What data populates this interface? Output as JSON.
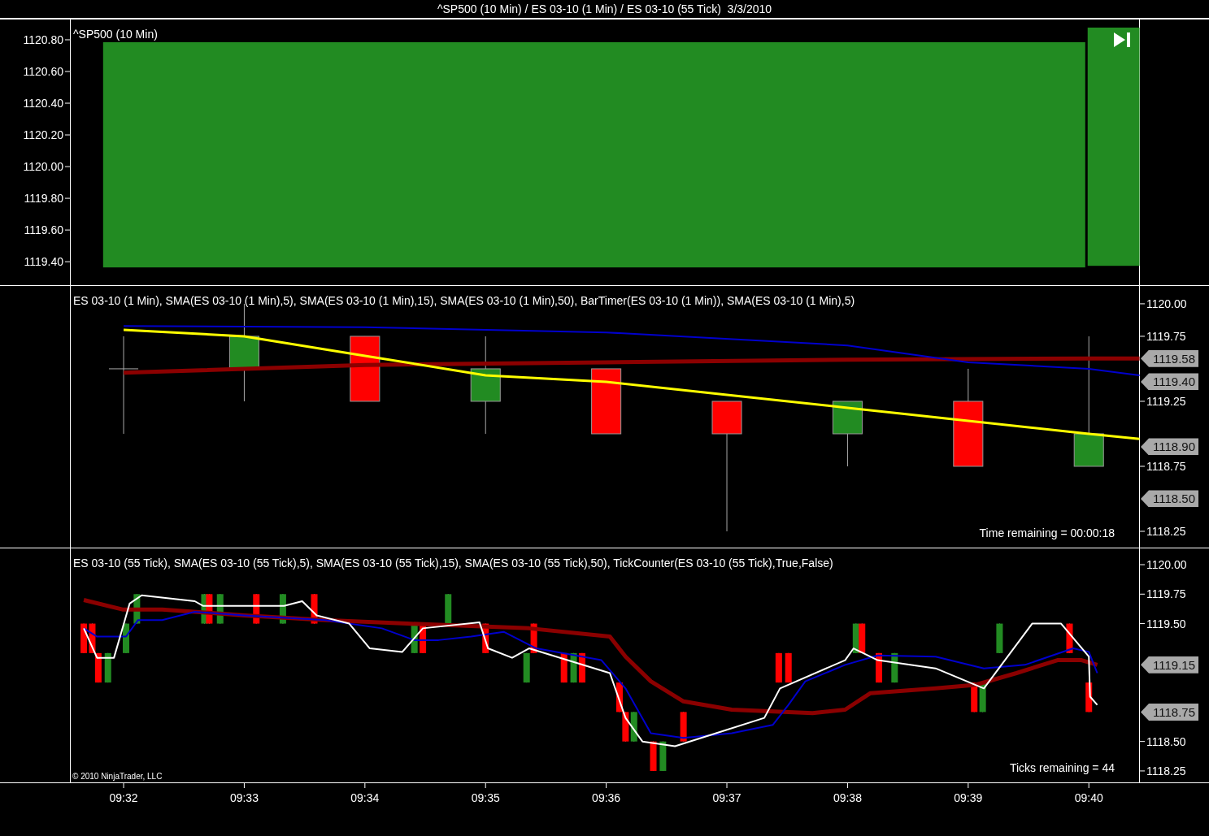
{
  "window": {
    "title": "^SP500 (10 Min) / ES 03-10 (1 Min) / ES 03-10 (55 Tick)  3/3/2010"
  },
  "panels": [
    {
      "kind": "overview",
      "label": "^SP500 (10 Min)",
      "axis_labels": [
        "1120.80",
        "1120.60",
        "1120.40",
        "1120.20",
        "1120.00",
        "1119.80",
        "1119.60",
        "1119.40"
      ]
    },
    {
      "kind": "minute",
      "label": "ES 03-10 (1 Min), SMA(ES 03-10 (1 Min),5), SMA(ES 03-10 (1 Min),15), SMA(ES 03-10 (1 Min),50), BarTimer(ES 03-10 (1 Min)), SMA(ES 03-10 (1 Min),5)",
      "footer": "Time remaining = 00:00:18",
      "axis_labels": [
        "1120.00",
        "1119.75",
        "1119.25",
        "1118.75",
        "1118.25"
      ],
      "markers": [
        {
          "value": "1119.58"
        },
        {
          "value": "1119.40"
        },
        {
          "value": "1118.90"
        },
        {
          "value": "1118.50"
        }
      ]
    },
    {
      "kind": "tick",
      "label": "ES 03-10 (55 Tick), SMA(ES 03-10 (55 Tick),5), SMA(ES 03-10 (55 Tick),15), SMA(ES 03-10 (55 Tick),50), TickCounter(ES 03-10 (55 Tick),True,False)",
      "footer": "Ticks remaining = 44",
      "axis_labels": [
        "1120.00",
        "1119.75",
        "1119.50",
        "1118.50",
        "1118.25"
      ],
      "markers": [
        {
          "value": "1119.15"
        },
        {
          "value": "1118.75"
        }
      ],
      "copyright": "© 2010 NinjaTrader, LLC"
    }
  ],
  "time_axis": [
    "09:32",
    "09:33",
    "09:34",
    "09:35",
    "09:36",
    "09:37",
    "09:38",
    "09:39",
    "09:40"
  ]
}
